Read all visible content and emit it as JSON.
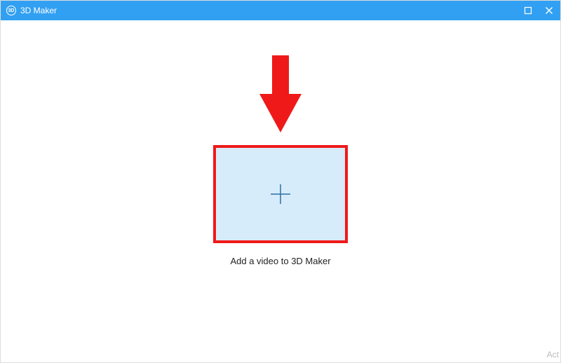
{
  "titlebar": {
    "app_icon_text": "3D",
    "title": "3D Maker"
  },
  "content": {
    "dropzone_label": "Add a video to 3D Maker"
  },
  "watermark": {
    "text": "Act"
  },
  "colors": {
    "titlebar_bg": "#32a0f2",
    "dropzone_bg": "#d7ecfb",
    "highlight_border": "#ef1919",
    "arrow_fill": "#ef1919",
    "plus_stroke": "#2b6fa3"
  }
}
